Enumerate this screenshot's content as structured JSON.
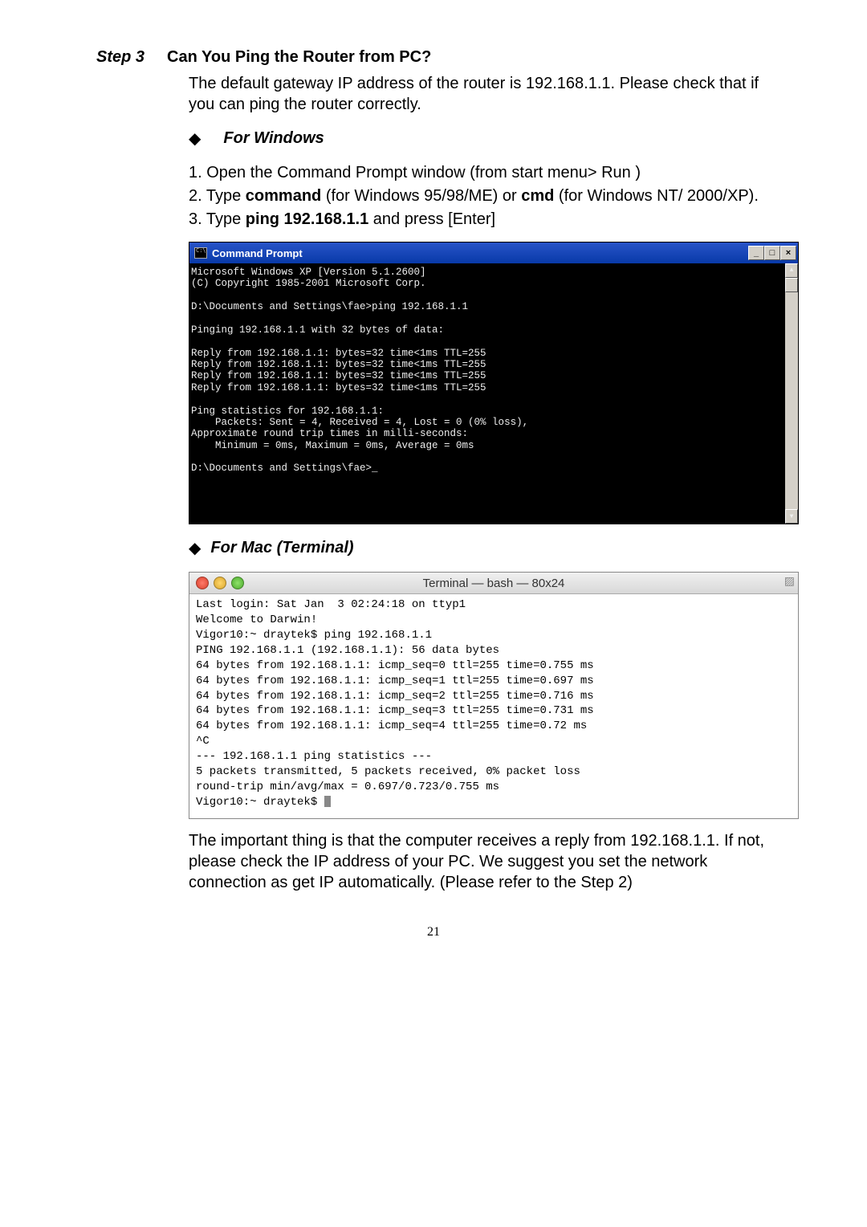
{
  "step_label": "Step 3",
  "step_title": "Can You Ping the Router from PC?",
  "intro": "The default gateway IP address of the router is 192.168.1.1. Please check that if you can ping the router correctly.",
  "bullet_win": "For Windows",
  "win_steps_1": "1. Open the Command Prompt window (from start menu> Run )",
  "win_steps_2a": "2. Type ",
  "win_steps_2b": "command",
  "win_steps_2c": " (for Windows 95/98/ME) or ",
  "win_steps_2d": "cmd",
  "win_steps_2e": " (for Windows NT/ 2000/XP).",
  "win_steps_3a": "3. Type ",
  "win_steps_3b": "ping 192.168.1.1",
  "win_steps_3c": " and press [Enter]",
  "cmd_title": "Command Prompt",
  "cmd_text": "Microsoft Windows XP [Version 5.1.2600]\n(C) Copyright 1985-2001 Microsoft Corp.\n\nD:\\Documents and Settings\\fae>ping 192.168.1.1\n\nPinging 192.168.1.1 with 32 bytes of data:\n\nReply from 192.168.1.1: bytes=32 time<1ms TTL=255\nReply from 192.168.1.1: bytes=32 time<1ms TTL=255\nReply from 192.168.1.1: bytes=32 time<1ms TTL=255\nReply from 192.168.1.1: bytes=32 time<1ms TTL=255\n\nPing statistics for 192.168.1.1:\n    Packets: Sent = 4, Received = 4, Lost = 0 (0% loss),\nApproximate round trip times in milli-seconds:\n    Minimum = 0ms, Maximum = 0ms, Average = 0ms\n\nD:\\Documents and Settings\\fae>_\n\n\n\n\n",
  "bullet_mac": "For Mac (Terminal)",
  "term_title": "Terminal — bash — 80x24",
  "term_text": "Last login: Sat Jan  3 02:24:18 on ttyp1\nWelcome to Darwin!\nVigor10:~ draytek$ ping 192.168.1.1\nPING 192.168.1.1 (192.168.1.1): 56 data bytes\n64 bytes from 192.168.1.1: icmp_seq=0 ttl=255 time=0.755 ms\n64 bytes from 192.168.1.1: icmp_seq=1 ttl=255 time=0.697 ms\n64 bytes from 192.168.1.1: icmp_seq=2 ttl=255 time=0.716 ms\n64 bytes from 192.168.1.1: icmp_seq=3 ttl=255 time=0.731 ms\n64 bytes from 192.168.1.1: icmp_seq=4 ttl=255 time=0.72 ms\n^C\n--- 192.168.1.1 ping statistics ---\n5 packets transmitted, 5 packets received, 0% packet loss\nround-trip min/avg/max = 0.697/0.723/0.755 ms\nVigor10:~ draytek$ ",
  "closing": "The important thing is that the computer receives a reply from 192.168.1.1. If not, please check the IP address of your PC. We suggest you set the network connection as get IP automatically. (Please refer to the Step 2)",
  "page_num": "21",
  "win_btn_min": "_",
  "win_btn_max": "□",
  "win_btn_close": "×"
}
